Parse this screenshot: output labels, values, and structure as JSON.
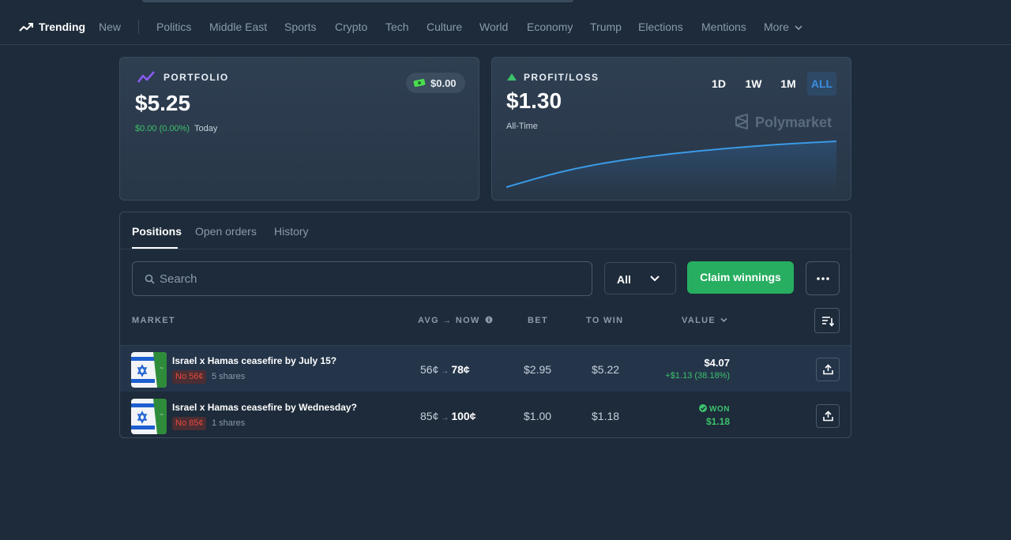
{
  "nav": {
    "items": [
      {
        "label": "Trending",
        "active": true
      },
      {
        "label": "New"
      },
      {
        "label": "Politics"
      },
      {
        "label": "Middle East"
      },
      {
        "label": "Sports"
      },
      {
        "label": "Crypto"
      },
      {
        "label": "Tech"
      },
      {
        "label": "Culture"
      },
      {
        "label": "World"
      },
      {
        "label": "Economy"
      },
      {
        "label": "Trump"
      },
      {
        "label": "Elections"
      },
      {
        "label": "Mentions"
      },
      {
        "label": "More"
      }
    ]
  },
  "portfolio": {
    "label": "PORTFOLIO",
    "value": "$5.25",
    "change": "$0.00 (0.00%)",
    "change_period": "Today",
    "cash": "$0.00"
  },
  "pnl": {
    "label": "PROFIT/LOSS",
    "value": "$1.30",
    "period": "All-Time",
    "ranges": [
      "1D",
      "1W",
      "1M",
      "ALL"
    ],
    "active_range": "ALL",
    "brand": "Polymarket",
    "chart_data": {
      "type": "area",
      "values": [
        0.0,
        0.45,
        0.75,
        0.95,
        1.1,
        1.22,
        1.3
      ]
    }
  },
  "positions": {
    "tabs": [
      "Positions",
      "Open orders",
      "History"
    ],
    "active_tab": "Positions",
    "search_placeholder": "Search",
    "filter": "All",
    "claim_label": "Claim winnings",
    "columns": {
      "market": "MARKET",
      "avg_now": "AVG → NOW",
      "bet": "BET",
      "to_win": "TO WIN",
      "value": "VALUE"
    },
    "rows": [
      {
        "title": "Israel x Hamas ceasefire by July 15?",
        "side": "No 56¢",
        "shares": "5 shares",
        "avg": "56¢",
        "now": "78¢",
        "bet": "$2.95",
        "to_win": "$5.22",
        "value": "$4.07",
        "value_change": "+$1.13 (38.18%)"
      },
      {
        "title": "Israel x Hamas ceasefire by Wednesday?",
        "side": "No 85¢",
        "shares": "1 shares",
        "avg": "85¢",
        "now": "100¢",
        "bet": "$1.00",
        "to_win": "$1.18",
        "status": "WON",
        "value": "$1.18"
      }
    ]
  },
  "colors": {
    "background": "#1d2b3a",
    "accent_green": "#27ae60",
    "accent_blue": "#3b8ee0",
    "loss_red": "#e5483d"
  }
}
